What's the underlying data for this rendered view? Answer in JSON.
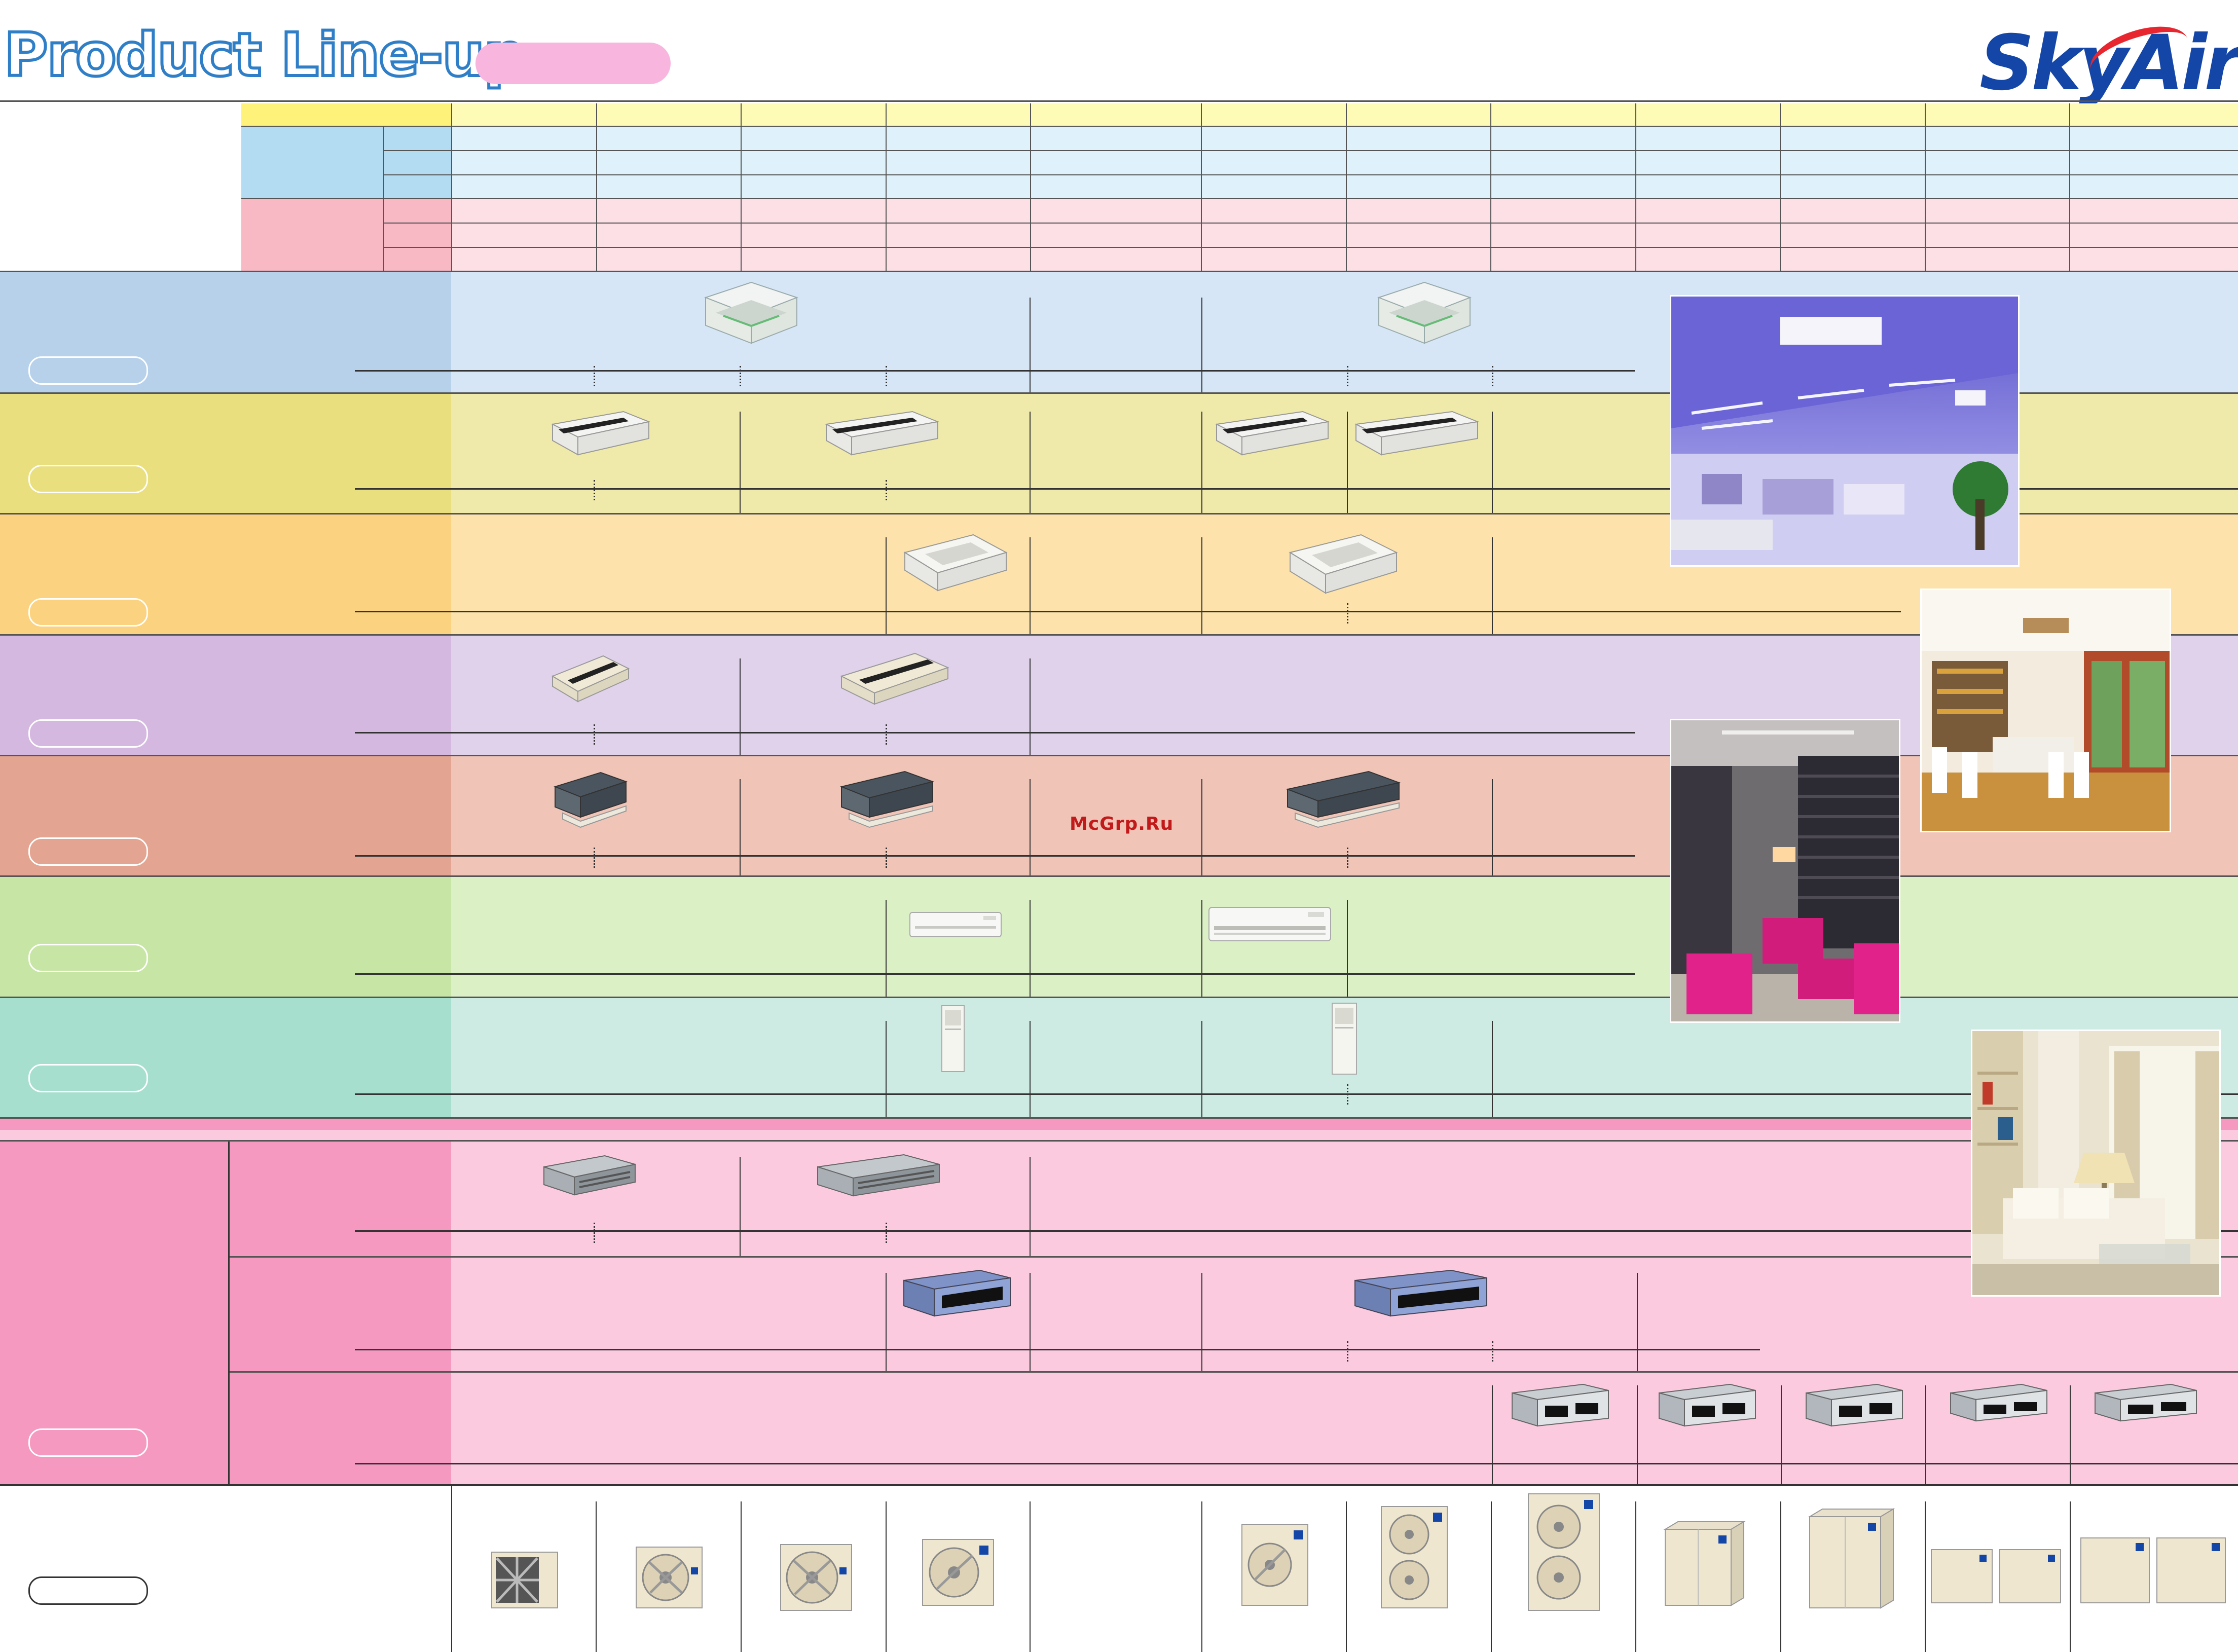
{
  "header": {
    "title": "Product Line-up",
    "logo": "SkyAir"
  },
  "watermark": "McGrp.Ru",
  "colors": {
    "title_stroke": "#2e7fc8",
    "title_tag": "#f8b6df",
    "logo_blue": "#1446a8",
    "logo_red": "#e8262f",
    "header_yellow": "#fefbb6",
    "header_blue": "#dff1fb",
    "header_pink": "#fde0e6",
    "row1": "#b7d1eb",
    "row2": "#e9df7f",
    "row3": "#fbd27f",
    "row4": "#d4b8e0",
    "row5": "#e3a592",
    "row6": "#c7e5a4",
    "row7": "#a7dfce",
    "ducted": "#f599c1",
    "outdoor": "#ffffff"
  },
  "rows": [
    {
      "icon": "ceiling-cassette-round-flow-icon"
    },
    {
      "icon": "ceiling-suspended-icon"
    },
    {
      "icon": "ceiling-cassette-compact-icon"
    },
    {
      "icon": "ceiling-cassette-corner-icon"
    },
    {
      "icon": "ceiling-mounted-builtin-icon"
    },
    {
      "icon": "wall-mounted-icon"
    },
    {
      "icon": "floor-standing-icon"
    },
    {
      "icon": "ceiling-mounted-duct-icon"
    },
    {
      "icon": "outdoor-unit-icon"
    }
  ]
}
